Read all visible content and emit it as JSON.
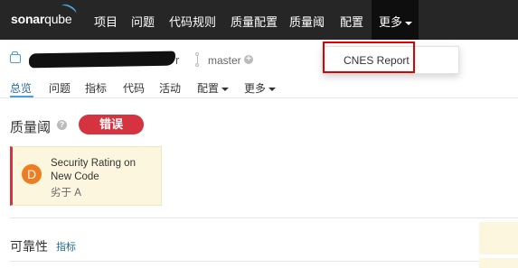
{
  "app": {
    "logo_text": "sonar",
    "logo_text_2": "qube"
  },
  "top_nav": {
    "items": [
      "项目",
      "问题",
      "代码规则",
      "质量配置",
      "质量阈",
      "配置",
      "更多"
    ]
  },
  "project": {
    "name_tail": "r",
    "branch": "master",
    "branch_add": "+"
  },
  "sub_nav": {
    "items": [
      "总览",
      "问题",
      "指标",
      "代码",
      "活动",
      "配置",
      "更多"
    ]
  },
  "more_menu": {
    "items": [
      "CNES Report"
    ]
  },
  "quality_gate": {
    "title": "质量阈",
    "help": "?",
    "status": "错误",
    "conditions": [
      {
        "rating": "D",
        "label": "Security Rating on New Code",
        "value": "劣于 A"
      }
    ]
  },
  "reliability": {
    "title": "可靠性",
    "link": "指标"
  },
  "colors": {
    "topbar": "#262626",
    "accent": "#4b9fd5",
    "error": "#d4333f",
    "rating_d": "#ed7d20",
    "highlight": "#e00000"
  }
}
